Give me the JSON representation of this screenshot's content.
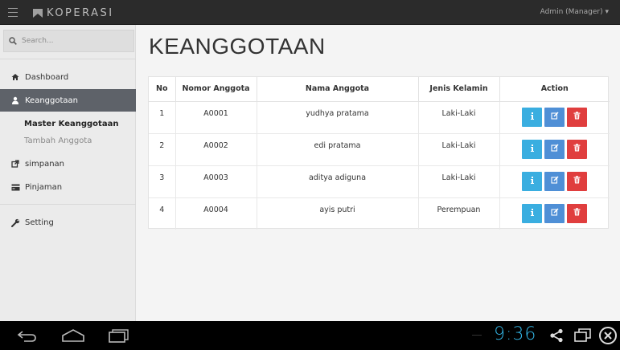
{
  "topbar": {
    "brand": "KOPERASI",
    "user_menu": "Admin (Manager) ▾"
  },
  "sidebar": {
    "search_placeholder": "Search...",
    "items": [
      {
        "label": "Dashboard",
        "icon": "home-icon"
      },
      {
        "label": "Keanggotaan",
        "icon": "user-icon",
        "active": true
      },
      {
        "label": "simpanan",
        "icon": "external-link-icon"
      },
      {
        "label": "Pinjaman",
        "icon": "credit-card-icon"
      },
      {
        "label": "Setting",
        "icon": "wrench-icon"
      }
    ],
    "subitems": [
      {
        "label": "Master Keanggotaan"
      },
      {
        "label": "Tambah Anggota"
      }
    ]
  },
  "main": {
    "title": "KEANGGOTAAN",
    "table": {
      "headers": [
        "No",
        "Nomor Anggota",
        "Nama Anggota",
        "Jenis Kelamin",
        "Action"
      ],
      "rows": [
        {
          "no": "1",
          "nomor": "A0001",
          "nama": "yudhya pratama",
          "jk": "Laki-Laki"
        },
        {
          "no": "2",
          "nomor": "A0002",
          "nama": "edi pratama",
          "jk": "Laki-Laki"
        },
        {
          "no": "3",
          "nomor": "A0003",
          "nama": "aditya adiguna",
          "jk": "Laki-Laki"
        },
        {
          "no": "4",
          "nomor": "A0004",
          "nama": "ayis putri",
          "jk": "Perempuan"
        }
      ],
      "action_icons": [
        "info-icon",
        "edit-icon",
        "trash-icon"
      ]
    }
  },
  "system_bar": {
    "time": "9:36"
  },
  "colors": {
    "topbar": "#2b2b2b",
    "sidebar_active": "#5e6269",
    "btn_info": "#3aaee0",
    "btn_edit": "#4f8fd6",
    "btn_delete": "#e03e3e",
    "clock": "#33b5e5"
  }
}
